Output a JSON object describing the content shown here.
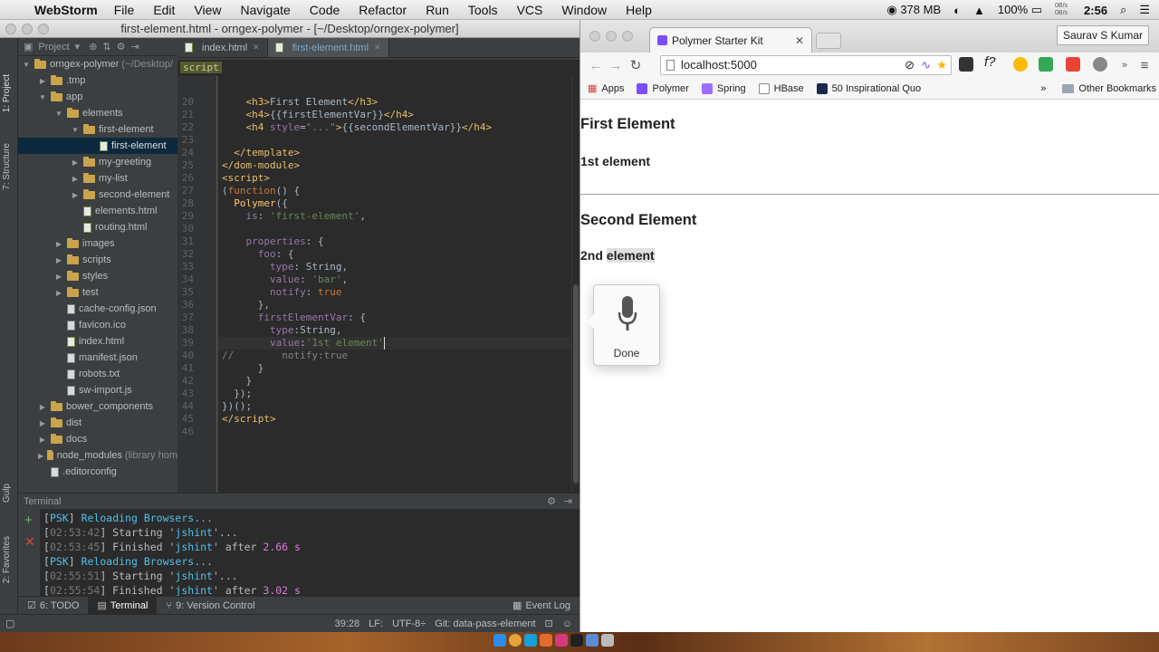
{
  "menubar": {
    "app_name": "WebStorm",
    "items": [
      "File",
      "Edit",
      "View",
      "Navigate",
      "Code",
      "Refactor",
      "Run",
      "Tools",
      "VCS",
      "Window",
      "Help"
    ],
    "memory": "378 MB",
    "net_up": "0B/s",
    "net_down": "0B/s",
    "battery": "100%",
    "time": "2:56"
  },
  "ide": {
    "window_title": "first-element.html - orngex-polymer - [~/Desktop/orngex-polymer]",
    "project_label": "Project",
    "side_labels": {
      "project": "1: Project",
      "structure": "7: Structure",
      "gulp": "Gulp",
      "favorites": "2: Favorites"
    },
    "tabs": [
      {
        "label": "index.html",
        "active": false
      },
      {
        "label": "first-element.html",
        "active": true
      }
    ],
    "breadcrumb": "script",
    "tree": [
      {
        "label": "orngex-polymer",
        "suffix": "(~/Desktop/",
        "depth": 0,
        "type": "folder",
        "open": true
      },
      {
        "label": ".tmp",
        "depth": 1,
        "type": "folder",
        "open": false
      },
      {
        "label": "app",
        "depth": 1,
        "type": "folder",
        "open": true
      },
      {
        "label": "elements",
        "depth": 2,
        "type": "folder",
        "open": true
      },
      {
        "label": "first-element",
        "depth": 3,
        "type": "folder",
        "open": true
      },
      {
        "label": "first-element",
        "depth": 4,
        "type": "html",
        "selected": true
      },
      {
        "label": "my-greeting",
        "depth": 3,
        "type": "folder",
        "open": false
      },
      {
        "label": "my-list",
        "depth": 3,
        "type": "folder",
        "open": false
      },
      {
        "label": "second-element",
        "depth": 3,
        "type": "folder",
        "open": false
      },
      {
        "label": "elements.html",
        "depth": 3,
        "type": "html"
      },
      {
        "label": "routing.html",
        "depth": 3,
        "type": "html"
      },
      {
        "label": "images",
        "depth": 2,
        "type": "folder",
        "open": false
      },
      {
        "label": "scripts",
        "depth": 2,
        "type": "folder",
        "open": false
      },
      {
        "label": "styles",
        "depth": 2,
        "type": "folder",
        "open": false
      },
      {
        "label": "test",
        "depth": 2,
        "type": "folder",
        "open": false
      },
      {
        "label": "cache-config.json",
        "depth": 2,
        "type": "file"
      },
      {
        "label": "favicon.ico",
        "depth": 2,
        "type": "file"
      },
      {
        "label": "index.html",
        "depth": 2,
        "type": "html"
      },
      {
        "label": "manifest.json",
        "depth": 2,
        "type": "file"
      },
      {
        "label": "robots.txt",
        "depth": 2,
        "type": "file"
      },
      {
        "label": "sw-import.js",
        "depth": 2,
        "type": "file"
      },
      {
        "label": "bower_components",
        "depth": 1,
        "type": "folder",
        "open": false
      },
      {
        "label": "dist",
        "depth": 1,
        "type": "folder",
        "open": false
      },
      {
        "label": "docs",
        "depth": 1,
        "type": "folder",
        "open": false
      },
      {
        "label": "node_modules",
        "suffix": "(library hom",
        "depth": 1,
        "type": "folder",
        "open": false
      },
      {
        "label": ".editorconfig",
        "depth": 1,
        "type": "file"
      }
    ],
    "code_lines": [
      {
        "n": "20",
        "html": "    <span class='tag'>&lt;h3&gt;</span>First Element<span class='tag'>&lt;/h3&gt;</span>"
      },
      {
        "n": "21",
        "html": "    <span class='tag'>&lt;h4&gt;</span>{{firstElementVar}}<span class='tag'>&lt;/h4&gt;</span>"
      },
      {
        "n": "22",
        "html": "    <span class='tag'>&lt;h4 </span><span class='prop'>style</span>=<span class='str'>\"...\"</span><span class='tag'>&gt;</span>{{secondElementVar}}<span class='tag'>&lt;/h4&gt;</span>"
      },
      {
        "n": "23",
        "html": ""
      },
      {
        "n": "24",
        "html": "  <span class='tag'>&lt;/template&gt;</span>"
      },
      {
        "n": "25",
        "html": "<span class='tag'>&lt;/dom-module&gt;</span>"
      },
      {
        "n": "26",
        "html": "<span class='tag'>&lt;script&gt;</span>"
      },
      {
        "n": "27",
        "html": "(<span class='kw'>function</span>() {"
      },
      {
        "n": "28",
        "html": "  <span class='fn'>Polymer</span>({"
      },
      {
        "n": "29",
        "html": "    <span class='prop'>is</span>: <span class='str'>'first-element'</span>,"
      },
      {
        "n": "30",
        "html": ""
      },
      {
        "n": "31",
        "html": "    <span class='prop'>properties</span>: {"
      },
      {
        "n": "32",
        "html": "      <span class='prop'>foo</span>: {"
      },
      {
        "n": "33",
        "html": "        <span class='prop'>type</span>: String,"
      },
      {
        "n": "34",
        "html": "        <span class='prop'>value</span>: <span class='str'>'bar'</span>,"
      },
      {
        "n": "35",
        "html": "        <span class='prop'>notify</span>: <span class='kw'>true</span>"
      },
      {
        "n": "36",
        "html": "      },"
      },
      {
        "n": "37",
        "html": "      <span class='prop'>firstElementVar</span>: {"
      },
      {
        "n": "38",
        "html": "        <span class='prop'>type</span>:String,"
      },
      {
        "n": "39",
        "html": "        <span class='prop'>value</span>:<span class='str'>'1st element'</span>"
      },
      {
        "n": "40",
        "html": "<span class='cm'>//        notify:true</span>"
      },
      {
        "n": "41",
        "html": "      }"
      },
      {
        "n": "42",
        "html": "    }"
      },
      {
        "n": "43",
        "html": "  });"
      },
      {
        "n": "44",
        "html": "})();"
      },
      {
        "n": "45",
        "html": "<span class='tag'>&lt;/script&gt;</span>"
      },
      {
        "n": "46",
        "html": ""
      }
    ],
    "terminal_title": "Terminal",
    "terminal_lines": [
      {
        "html": "[<span class='t-cyan'>PSK</span>] <span class='t-cyan'>Reloading Browsers...</span>"
      },
      {
        "html": "[<span class='t-gray'>02:53:42</span>] Starting '<span class='t-cyan'>jshint</span>'..."
      },
      {
        "html": "[<span class='t-gray'>02:53:45</span>] Finished '<span class='t-cyan'>jshint</span>' after <span class='t-mag'>2.66 s</span>"
      },
      {
        "html": "[<span class='t-cyan'>PSK</span>] <span class='t-cyan'>Reloading Browsers...</span>"
      },
      {
        "html": "[<span class='t-gray'>02:55:51</span>] Starting '<span class='t-cyan'>jshint</span>'..."
      },
      {
        "html": "[<span class='t-gray'>02:55:54</span>] Finished '<span class='t-cyan'>jshint</span>' after <span class='t-mag'>3.02 s</span>"
      }
    ],
    "bottom_tabs": [
      {
        "label": "6: TODO",
        "active": false
      },
      {
        "label": "Terminal",
        "active": true
      },
      {
        "label": "9: Version Control",
        "active": false
      }
    ],
    "event_log": "Event Log",
    "status": {
      "position": "39:28",
      "line_sep": "LF:",
      "encoding": "UTF-8÷",
      "git": "Git: data-pass-element"
    }
  },
  "browser": {
    "tab_title": "Polymer Starter Kit",
    "user": "Saurav S Kumar",
    "url": "localhost:5000",
    "bookmarks": [
      "Apps",
      "Polymer",
      "Spring",
      "HBase",
      "50 Inspirational Quo"
    ],
    "other_bookmarks": "Other Bookmarks",
    "page": {
      "h1": "First Element",
      "h1_sub": "1st element",
      "h2": "Second Element",
      "h2_sub_prefix": "2nd",
      "h2_sub_highlight": "element"
    },
    "mic_popup": {
      "done": "Done"
    }
  },
  "colors": {
    "ide_bg": "#2b2b2b",
    "tag": "#e8bf6a",
    "keyword": "#cc7832",
    "string": "#6a8759",
    "property": "#9876aa"
  }
}
